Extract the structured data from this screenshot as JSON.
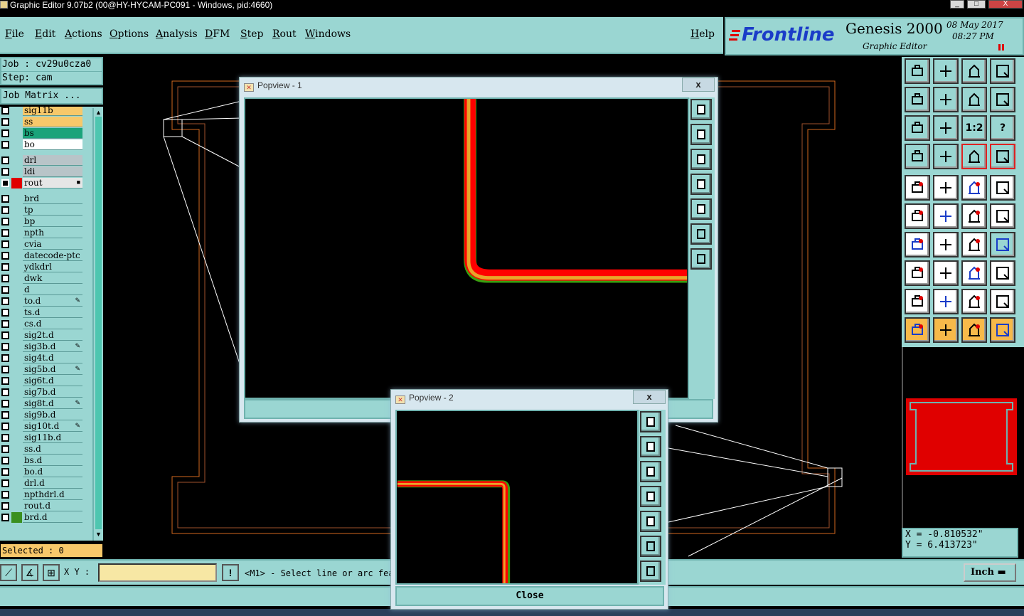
{
  "window": {
    "title": "Graphic Editor 9.07b2 (00@HY-HYCAM-PC091 - Windows, pid:4660)",
    "minimize": "_",
    "maximize": "□",
    "close": "X"
  },
  "menu": {
    "items": [
      "File",
      "Edit",
      "Actions",
      "Options",
      "Analysis",
      "DFM",
      "Step",
      "Rout",
      "Windows"
    ],
    "help": "Help"
  },
  "logo": {
    "brand": "Frontline",
    "product": "Genesis 2000",
    "subtitle": "Graphic Editor",
    "date": "08 May 2017",
    "time": "08:27 PM"
  },
  "job": {
    "job_line": "Job : cv29u0cza0",
    "step_line": "Step: cam",
    "matrix_button": "Job Matrix ..."
  },
  "layers": [
    {
      "name": "sig11b",
      "color": "#f7c86a",
      "marker": ""
    },
    {
      "name": "ss",
      "color": "#f7c86a",
      "marker": ""
    },
    {
      "name": "bs",
      "color": "#1aa37a",
      "marker": ""
    },
    {
      "name": "bo",
      "color": "#ffffff",
      "marker": ""
    },
    {
      "name": "drl",
      "color": "#b8c4c8",
      "marker": ""
    },
    {
      "name": "ldi",
      "color": "#b8c4c8",
      "marker": ""
    },
    {
      "name": "rout",
      "color": "#e6e6e6",
      "marker": "■",
      "active": true
    },
    {
      "name": "brd",
      "color": "#9ad6d2",
      "marker": ""
    },
    {
      "name": "tp",
      "color": "#9ad6d2",
      "marker": ""
    },
    {
      "name": "bp",
      "color": "#9ad6d2",
      "marker": ""
    },
    {
      "name": "npth",
      "color": "#9ad6d2",
      "marker": ""
    },
    {
      "name": "cvia",
      "color": "#9ad6d2",
      "marker": ""
    },
    {
      "name": "datecode-ptc",
      "color": "#9ad6d2",
      "marker": ""
    },
    {
      "name": "ydkdrl",
      "color": "#9ad6d2",
      "marker": ""
    },
    {
      "name": "dwk",
      "color": "#9ad6d2",
      "marker": ""
    },
    {
      "name": "d",
      "color": "#9ad6d2",
      "marker": ""
    },
    {
      "name": "to.d",
      "color": "#9ad6d2",
      "marker": "✎"
    },
    {
      "name": "ts.d",
      "color": "#9ad6d2",
      "marker": ""
    },
    {
      "name": "cs.d",
      "color": "#9ad6d2",
      "marker": ""
    },
    {
      "name": "sig2t.d",
      "color": "#9ad6d2",
      "marker": ""
    },
    {
      "name": "sig3b.d",
      "color": "#9ad6d2",
      "marker": "✎"
    },
    {
      "name": "sig4t.d",
      "color": "#9ad6d2",
      "marker": ""
    },
    {
      "name": "sig5b.d",
      "color": "#9ad6d2",
      "marker": "✎"
    },
    {
      "name": "sig6t.d",
      "color": "#9ad6d2",
      "marker": ""
    },
    {
      "name": "sig7b.d",
      "color": "#9ad6d2",
      "marker": ""
    },
    {
      "name": "sig8t.d",
      "color": "#9ad6d2",
      "marker": "✎"
    },
    {
      "name": "sig9b.d",
      "color": "#9ad6d2",
      "marker": ""
    },
    {
      "name": "sig10t.d",
      "color": "#9ad6d2",
      "marker": "✎"
    },
    {
      "name": "sig11b.d",
      "color": "#9ad6d2",
      "marker": ""
    },
    {
      "name": "ss.d",
      "color": "#9ad6d2",
      "marker": ""
    },
    {
      "name": "bs.d",
      "color": "#9ad6d2",
      "marker": ""
    },
    {
      "name": "bo.d",
      "color": "#9ad6d2",
      "marker": ""
    },
    {
      "name": "drl.d",
      "color": "#9ad6d2",
      "marker": ""
    },
    {
      "name": "npthdrl.d",
      "color": "#9ad6d2",
      "marker": ""
    },
    {
      "name": "rout.d",
      "color": "#9ad6d2",
      "marker": ""
    },
    {
      "name": "brd.d",
      "color": "#9ad6d2",
      "marker": "",
      "swatch": "#3a8f1f"
    }
  ],
  "selected": "Selected : 0",
  "bottom": {
    "xy_label": "X Y :",
    "warn": "!",
    "prompt": "<M1> - Select line or arc fea",
    "units": "Inch"
  },
  "coords": {
    "x": "X = -0.810532\"",
    "y": "Y = 6.413723\""
  },
  "popview1": {
    "title": "Popview - 1",
    "close_x": "x"
  },
  "popview2": {
    "title": "Popview - 2",
    "close_x": "x",
    "close_button": "Close"
  },
  "tools": {
    "zoom_12": "1:2",
    "help_q": "?",
    "unit_toggle": "⊐"
  },
  "colors": {
    "panel": "#9ad6d2",
    "panel_border": "#6fb2ae",
    "trace_red": "#ff0000",
    "trace_orange": "#e8a52a",
    "trace_green": "#3aa00f",
    "outline": "#d2691e"
  }
}
